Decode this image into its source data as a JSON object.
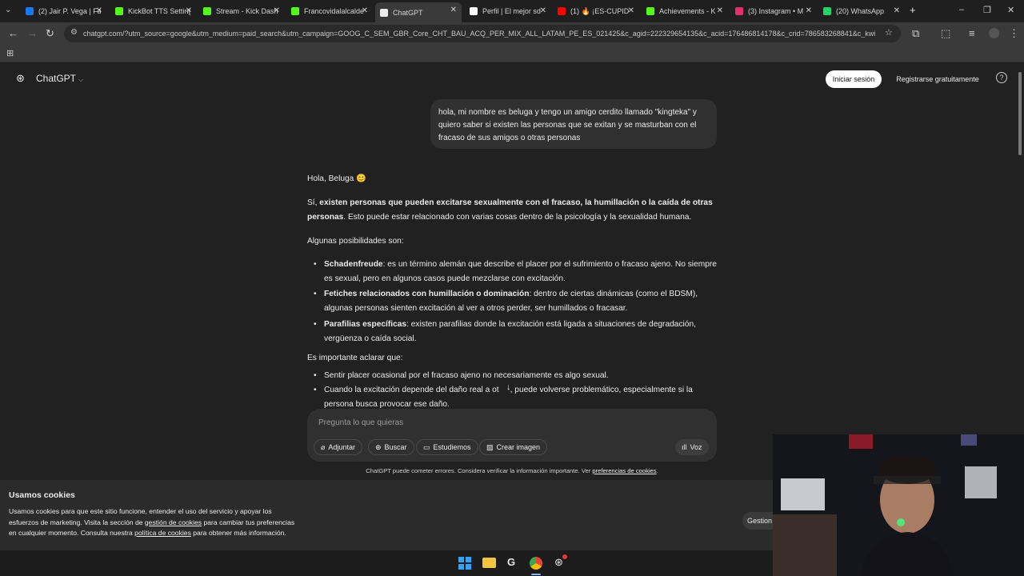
{
  "browser": {
    "tabs": [
      {
        "title": "(2) Jair P. Vega | Fa",
        "color": "#1877f2"
      },
      {
        "title": "KickBot TTS Setting",
        "color": "#53fc18"
      },
      {
        "title": "Stream - Kick Dash",
        "color": "#53fc18"
      },
      {
        "title": "Francovidalalcalde",
        "color": "#53fc18"
      },
      {
        "title": "ChatGPT",
        "color": "#ececec",
        "active": true
      },
      {
        "title": "Perfil | El mejor sd",
        "color": "#ffffff"
      },
      {
        "title": "(1) 🔥 ¡ES-CUPID",
        "color": "#ff0000"
      },
      {
        "title": "Achievements - K",
        "color": "#53fc18"
      },
      {
        "title": "(3) Instagram • M",
        "color": "#e1306c"
      },
      {
        "title": "(20) WhatsApp",
        "color": "#25d366"
      }
    ],
    "url": "chatgpt.com/?utm_source=google&utm_medium=paid_search&utm_campaign=GOOG_C_SEM_GBR_Core_CHT_BAU_ACQ_PER_MIX_ALL_LATAM_PE_ES_021425&c_agid=222329654135&c_acid=176486814178&c_crid=786583268841&c_kwid={k..."
  },
  "header": {
    "app_name": "ChatGPT",
    "login_label": "Iniciar sesión",
    "register_label": "Registrarse gratuitamente"
  },
  "chat": {
    "user_message": "hola,  mi nombre es beluga y  tengo un amigo cerdito llamado \"kingteka\"  y quiero  saber si existen las personas que se exitan y se masturban con el fracaso de sus amigos o otras personas",
    "greeting": "Hola, Beluga 😊",
    "para1_lead": "Sí, ",
    "para1_bold": "existen personas que pueden excitarse sexualmente con el fracaso, la humillación o la caída de otras personas",
    "para1_rest": ". Esto puede estar relacionado con varias cosas dentro de la psicología y la sexualidad humana.",
    "para2": "Algunas posibilidades son:",
    "bullets": [
      {
        "bold": "Schadenfreude",
        "text": ": es un término alemán que describe el placer por el sufrimiento o fracaso ajeno. No siempre es sexual, pero en algunos casos puede mezclarse con excitación."
      },
      {
        "bold": "Fetiches relacionados con humillación o dominación",
        "text": ": dentro de ciertas dinámicas (como el BDSM), algunas personas sienten excitación al ver a otros perder, ser humillados o fracasar."
      },
      {
        "bold": "Parafilias específicas",
        "text": ": existen parafilias donde la excitación está ligada a situaciones de degradación, vergüenza o caída social."
      }
    ],
    "para3": "Es importante aclarar que:",
    "bullets2": [
      "Sentir placer ocasional por el fracaso ajeno no necesariamente es algo sexual.",
      "Cuando la excitación depende del daño real a ot",
      ", puede volverse problemático, especialmente si la persona busca provocar ese daño."
    ]
  },
  "composer": {
    "placeholder": "Pregunta lo que quieras",
    "attach_label": "Adjuntar",
    "search_label": "Buscar",
    "study_label": "Estudiemos",
    "image_label": "Crear imagen",
    "voice_label": "Voz",
    "disclaimer": "ChatGPT puede cometer errores. Considera verificar la información importante. Ver",
    "disclaimer_link": "preferencias de cookies",
    "disclaimer_end": "."
  },
  "cookies": {
    "title": "Usamos cookies",
    "text1": "Usamos cookies para que este sitio funcione, entender el uso del servicio y apoyar los",
    "text2a": "esfuerzos de marketing. Visita la sección de ",
    "link1": "gestión de cookies",
    "text2b": " para cambiar tus preferencias",
    "text3a": "en cualquier momento. Consulta nuestra ",
    "link2": "política de cookies",
    "text3b": " para obtener más información.",
    "manage_label": "Gestion"
  }
}
